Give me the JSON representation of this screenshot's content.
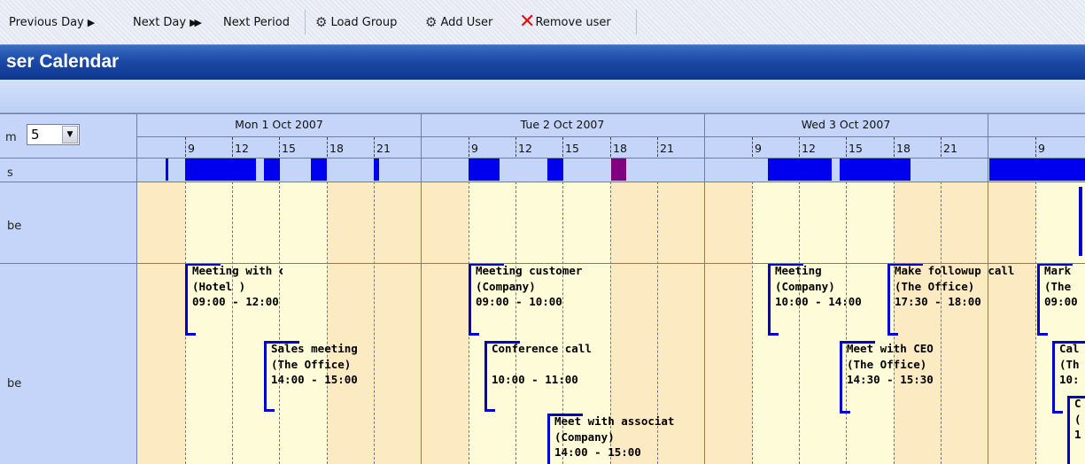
{
  "toolbar": {
    "prev_day": "Previous Day",
    "next_day": "Next Day",
    "next_period": "Next Period",
    "load_group": "Load Group",
    "add_user": "Add User",
    "remove_user": "Remove user"
  },
  "title": "ser Calendar",
  "left": {
    "zoom_label": "m",
    "zoom_value": "5",
    "busy_label": "s",
    "user1_label": "be",
    "user2_label": "be"
  },
  "days": [
    {
      "label": "Mon 1 Oct 2007",
      "hours": [
        "9",
        "12",
        "15",
        "18",
        "21"
      ]
    },
    {
      "label": "Tue 2 Oct 2007",
      "hours": [
        "9",
        "12",
        "15",
        "18",
        "21"
      ]
    },
    {
      "label": "Wed 3 Oct 2007",
      "hours": [
        "9",
        "12",
        "15",
        "18",
        "21"
      ]
    },
    {
      "label": "",
      "hours": [
        "9"
      ]
    }
  ],
  "events": [
    {
      "title": "Meeting with custo",
      "sub": "(Hotel )",
      "time": "09:00 - 12:00"
    },
    {
      "title": "Sales meeting",
      "sub": "(The Office)",
      "time": "14:00 - 15:00"
    },
    {
      "title": "Meeting customer",
      "sub": "(Company)",
      "time": "09:00 - 10:00"
    },
    {
      "title": "Conference call",
      "sub": "",
      "time": "10:00 - 11:00"
    },
    {
      "title": "Meet with associat",
      "sub": "(Company)",
      "time": "14:00 - 15:00"
    },
    {
      "title": "Meeting",
      "sub": "(Company)",
      "time": "10:00 - 14:00"
    },
    {
      "title": "Make followup call",
      "sub": "(The Office)",
      "time": "17:30 - 18:00"
    },
    {
      "title": "Meet with CEO",
      "sub": "(The Office)",
      "time": "14:30 - 15:30"
    },
    {
      "title": "Mark",
      "sub": "(The",
      "time": "09:00"
    },
    {
      "title": "Cal",
      "sub": "(Th",
      "time": "10:"
    },
    {
      "title": "C",
      "sub": "(",
      "time": "1"
    }
  ],
  "colors": {
    "busy": "#0000ee",
    "busy_alt": "#800080",
    "title_bar": "#1c4aa7",
    "offhours": "#fcebc2",
    "workhours": "#fefbd8"
  }
}
